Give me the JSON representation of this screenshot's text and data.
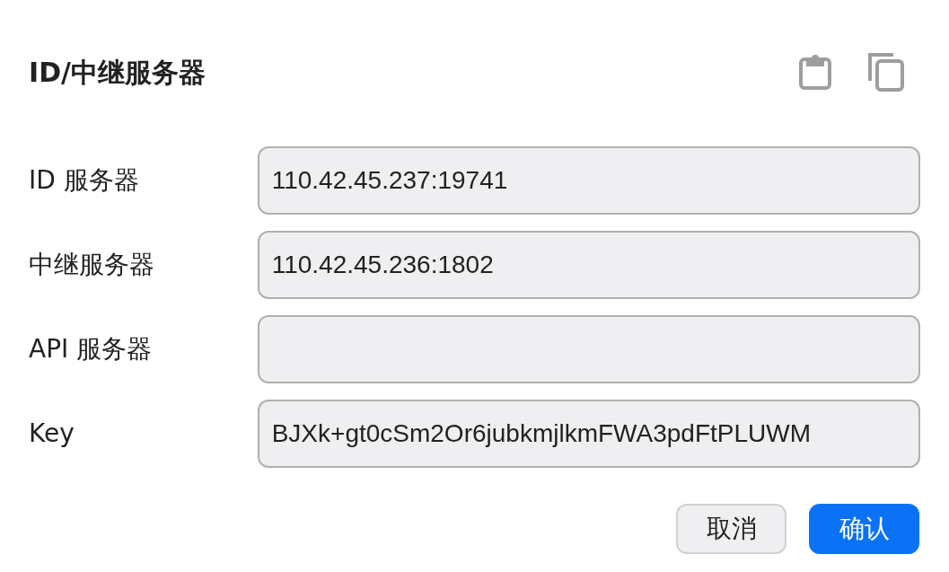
{
  "dialog": {
    "title": "ID/中继服务器"
  },
  "fields": [
    {
      "label": "ID 服务器",
      "value": "110.42.45.237:19741"
    },
    {
      "label": "中继服务器",
      "value": "110.42.45.236:1802"
    },
    {
      "label": "API 服务器"
    },
    {
      "label": "Key",
      "value": "BJXk+gt0cSm2Or6jubkmjlkmFWA3pdFtPLUWM"
    }
  ],
  "buttons": [
    {
      "label": "取消",
      "kind": "secondary"
    },
    {
      "label": "确认",
      "kind": "primary"
    }
  ]
}
